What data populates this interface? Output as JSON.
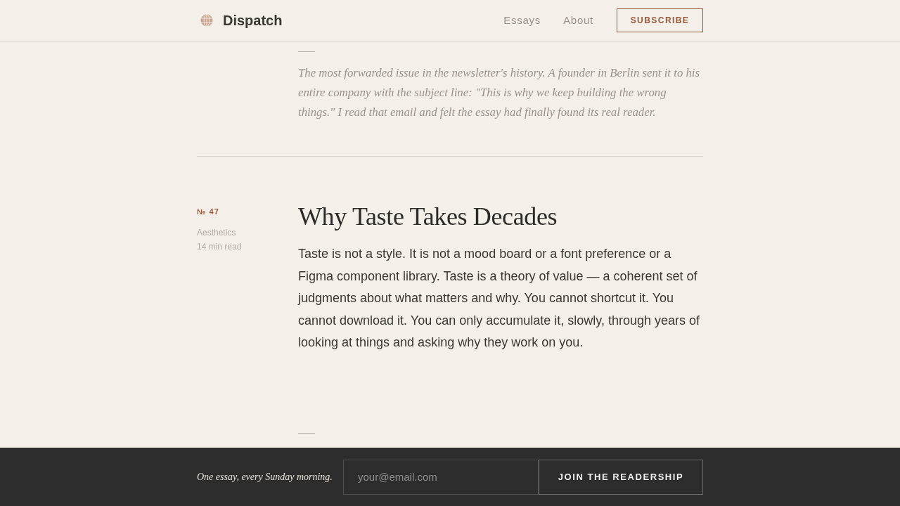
{
  "header": {
    "brand": "Dispatch",
    "nav": [
      {
        "label": "Essays"
      },
      {
        "label": "About"
      }
    ],
    "subscribe_button": "SUBSCRIBE"
  },
  "entries": [
    {
      "kind": "note",
      "text": "The most forwarded issue in the newsletter's history. A founder in Berlin sent it to his entire company with the subject line: \"This is why we keep building the wrong things.\" I read that email and felt the essay had finally found its real reader."
    },
    {
      "kind": "essay",
      "number": "№ 47",
      "category": "Aesthetics",
      "read_time": "14 min read",
      "title": "Why Taste Takes Decades",
      "body": "Taste is not a style. It is not a mood board or a font preference or a Figma component library. Taste is a theory of value — a coherent set of judgments about what matters and why. You cannot shortcut it. You cannot download it. You can only accumulate it, slowly, through years of looking at things and asking why they work on you."
    }
  ],
  "footer": {
    "tagline": "One essay, every Sunday morning.",
    "email_field": {
      "placeholder": "your@email.com"
    },
    "join_button": "JOIN THE READERSHIP"
  }
}
